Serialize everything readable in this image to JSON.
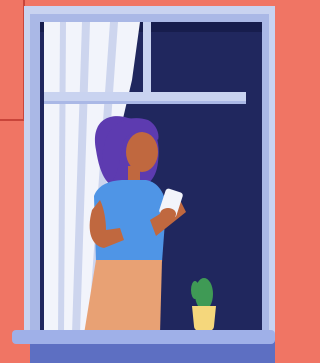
{
  "scene": {
    "description_tags": [
      "woman",
      "phone",
      "window",
      "curtain",
      "cactus"
    ],
    "palette": {
      "wall": "#f07564",
      "wall_line": "#c9453a",
      "frame_outer": "#c9d3f0",
      "frame_inner": "#aab8e6",
      "room": "#20275e",
      "room_shadow": "#171d4d",
      "curtain": "#f2f4fb",
      "curtain_shade": "#cdd5ee",
      "hair": "#5d3bb0",
      "skin": "#c0683f",
      "blouse": "#4f95e6",
      "skirt": "#e8a174",
      "phone": "#f2f4fb",
      "pot": "#f5d77c",
      "cactus": "#3f9a55",
      "sill": "#9fb0e8",
      "sill_shadow": "#5d6fc2"
    }
  }
}
